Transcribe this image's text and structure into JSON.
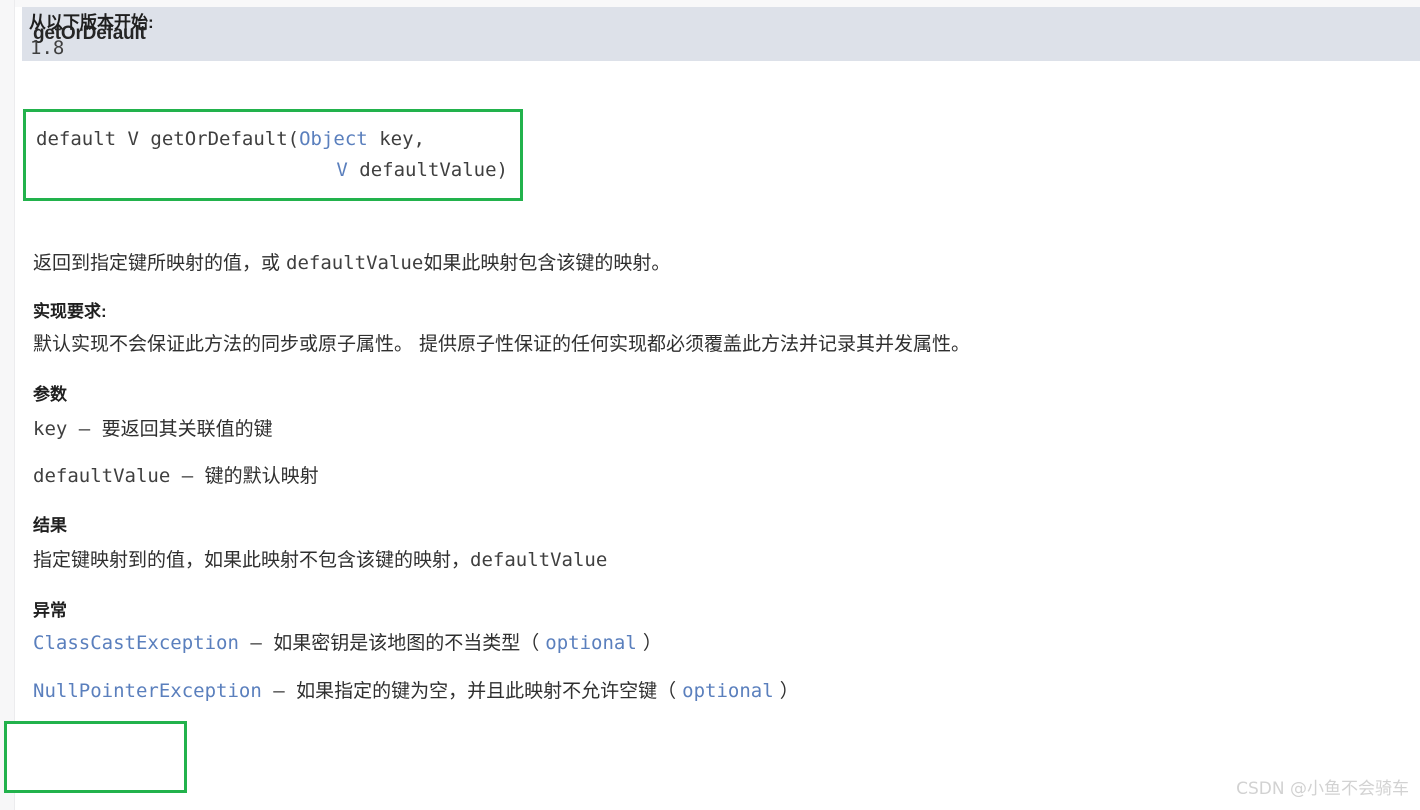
{
  "header": {
    "title": "getOrDefault",
    "background_color": "#dde1e9"
  },
  "signature": {
    "line1_prefix": "default V getOrDefault(",
    "line1_type": "Object",
    "line1_suffix": " key,",
    "line2_type": "V",
    "line2_suffix": " defaultValue)",
    "border_color": "#22b24c"
  },
  "description": {
    "part1": "返回到指定键所映射的值，或 ",
    "code": "defaultValue",
    "part2": "如果此映射包含该键的映射。"
  },
  "impl_requirements": {
    "heading": "实现要求:",
    "text": "默认实现不会保证此方法的同步或原子属性。 提供原子性保证的任何实现都必须覆盖此方法并记录其并发属性。"
  },
  "parameters": {
    "heading": "参数",
    "items": [
      {
        "name": "key",
        "separator": " – ",
        "desc": "要返回其关联值的键"
      },
      {
        "name": "defaultValue",
        "separator": " – ",
        "desc": "键的默认映射"
      }
    ]
  },
  "returns": {
    "heading": "结果",
    "text": "指定键映射到的值，如果此映射不包含该键的映射，",
    "code": "defaultValue"
  },
  "throws": {
    "heading": "异常",
    "items": [
      {
        "exception": "ClassCastException",
        "separator": " – ",
        "desc": "如果密钥是该地图的不当类型（ ",
        "optional": "optional",
        "tail": " ）"
      },
      {
        "exception": "NullPointerException",
        "separator": " – ",
        "desc": "如果指定的键为空，并且此映射不允许空键（ ",
        "optional": "optional",
        "tail": " ）"
      }
    ],
    "link_color": "#5a7fbd"
  },
  "since": {
    "heading": "从以下版本开始:",
    "value": "1.8",
    "border_color": "#22b24c"
  },
  "watermark": {
    "text": "CSDN @小鱼不会骑车"
  }
}
